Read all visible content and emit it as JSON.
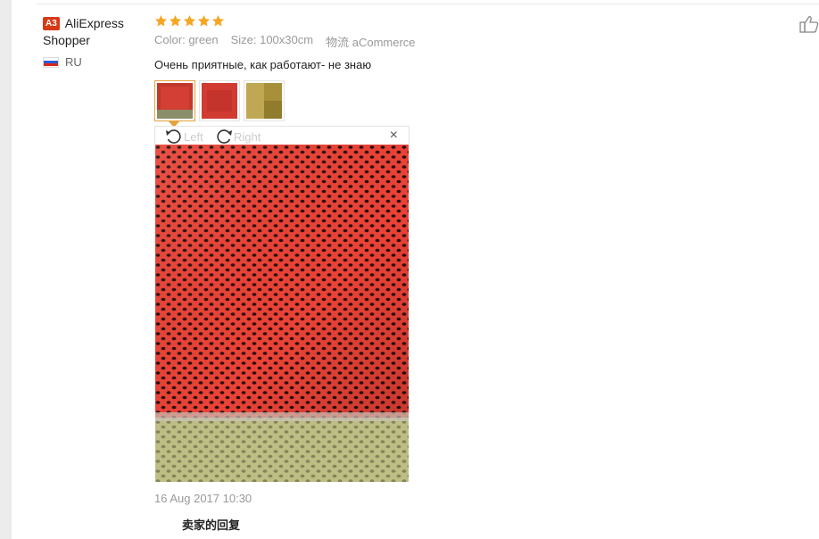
{
  "reviewer": {
    "level_badge": "A3",
    "name": "AliExpress Shopper",
    "country_code": "RU",
    "flag_colors": [
      "#ffffff",
      "#2a5bd7",
      "#d52b1e"
    ]
  },
  "review": {
    "stars": 5,
    "star_color": "#f5a623",
    "attributes": [
      {
        "key": "Color:",
        "value": "green"
      },
      {
        "key": "Size:",
        "value": "100x30cm"
      },
      {
        "key": "物流",
        "value": "aCommerce"
      }
    ],
    "text": "Очень приятные, как работают- не знаю",
    "thumbnails": [
      {
        "name": "photo-thumb-1",
        "active": true
      },
      {
        "name": "photo-thumb-2",
        "active": false
      },
      {
        "name": "photo-thumb-3",
        "active": false
      }
    ],
    "viewer": {
      "rotate_left_label": "Left",
      "rotate_right_label": "Right",
      "close_glyph": "×"
    },
    "timestamp": "16 Aug 2017 10:30",
    "seller_reply_label": "卖家的回复"
  },
  "colors": {
    "accent_orange": "#e6a23c",
    "badge_red": "#d63a16",
    "mesh_red": "#e8413a"
  },
  "icons": {
    "like": "thumbs-up-icon",
    "rotate_left": "rotate-left-icon",
    "rotate_right": "rotate-right-icon",
    "close": "close-icon",
    "star": "star-icon"
  }
}
